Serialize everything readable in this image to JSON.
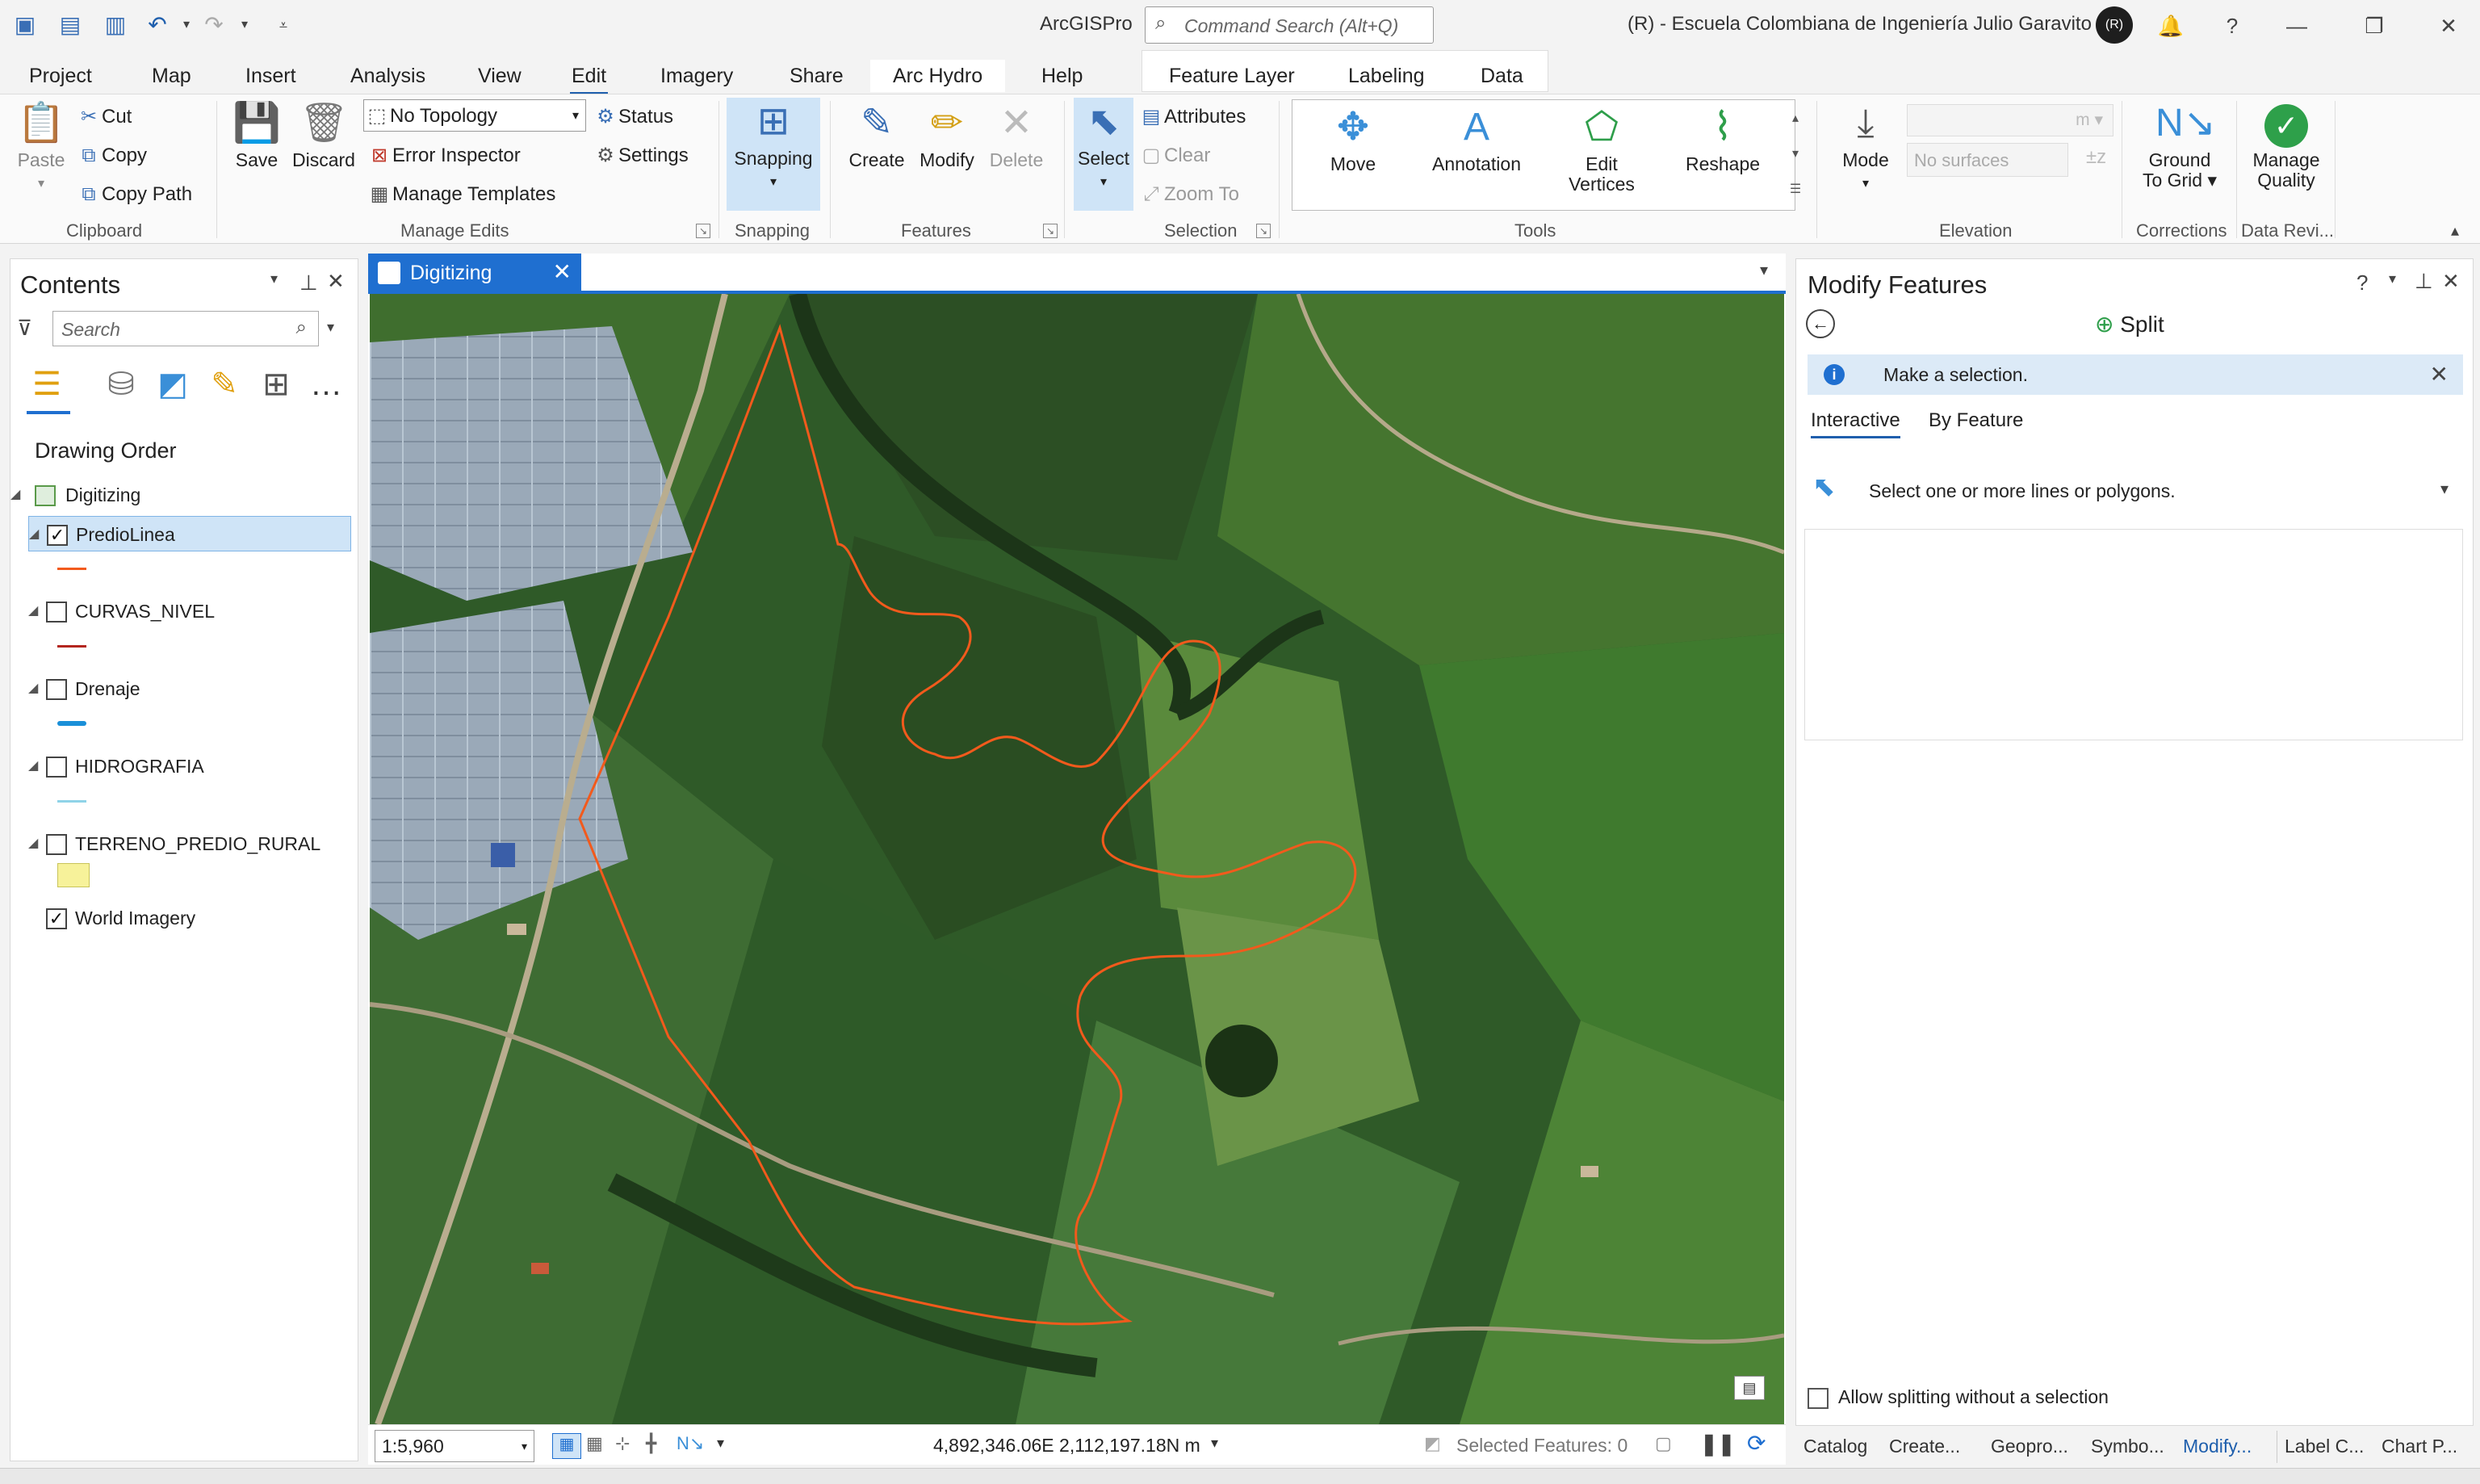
{
  "title_bar": {
    "app_title": "ArcGISPro",
    "command_search_placeholder": "Command Search (Alt+Q)",
    "user_org": "(R) - Escuela Colombiana de Ingeniería Julio Garavito",
    "avatar_initials": "(R)",
    "help": "?"
  },
  "ribbon_tabs": [
    "Project",
    "Map",
    "Insert",
    "Analysis",
    "View",
    "Edit",
    "Imagery",
    "Share",
    "Arc Hydro",
    "Help"
  ],
  "contextual_tabs": [
    "Feature Layer",
    "Labeling",
    "Data"
  ],
  "active_tab": "Edit",
  "ribbon": {
    "clipboard": {
      "label": "Clipboard",
      "paste": "Paste",
      "cut": "Cut",
      "copy": "Copy",
      "copy_path": "Copy Path"
    },
    "manage_edits": {
      "label": "Manage Edits",
      "save": "Save",
      "discard": "Discard",
      "topology_value": "No Topology",
      "status": "Status",
      "error_inspector": "Error Inspector",
      "settings": "Settings",
      "manage_templates": "Manage Templates"
    },
    "snapping": {
      "label": "Snapping",
      "button": "Snapping"
    },
    "features": {
      "label": "Features",
      "create": "Create",
      "modify": "Modify",
      "delete": "Delete"
    },
    "selection": {
      "label": "Selection",
      "select": "Select",
      "attributes": "Attributes",
      "clear": "Clear",
      "zoom_to": "Zoom To"
    },
    "tools": {
      "label": "Tools",
      "move": "Move",
      "annotation": "Annotation",
      "edit_vertices_1": "Edit",
      "edit_vertices_2": "Vertices",
      "reshape": "Reshape"
    },
    "elevation": {
      "label": "Elevation",
      "mode": "Mode",
      "unit": "m",
      "surface_placeholder": "No surfaces"
    },
    "corrections": {
      "label": "Corrections",
      "ground_to_grid_1": "Ground",
      "ground_to_grid_2": "To Grid"
    },
    "data_reviewer": {
      "label": "Data Revi...",
      "manage_quality_1": "Manage",
      "manage_quality_2": "Quality"
    }
  },
  "contents": {
    "title": "Contents",
    "search_placeholder": "Search",
    "drawing_order": "Drawing Order",
    "map_name": "Digitizing",
    "layers": [
      {
        "name": "PredioLinea",
        "checked": "✓",
        "color": "#f25a1c"
      },
      {
        "name": "CURVAS_NIVEL",
        "checked": "",
        "color": "#b3261e"
      },
      {
        "name": "Drenaje",
        "checked": "",
        "color": "#1a8fd8"
      },
      {
        "name": "HIDROGRAFIA",
        "checked": "",
        "color": "#8fd3e8"
      },
      {
        "name": "TERRENO_PREDIO_RURAL",
        "checked": "",
        "color": "#f7f29a"
      },
      {
        "name": "World Imagery",
        "checked": "✓",
        "color": ""
      }
    ]
  },
  "map_view": {
    "tab_label": "Digitizing",
    "scale": "1:5,960",
    "coordinates": "4,892,346.06E 2,112,197.18N m",
    "selected_features": "Selected Features: 0"
  },
  "modify_pane": {
    "title": "Modify Features",
    "tool": "Split",
    "info": "Make a selection.",
    "tabs": [
      "Interactive",
      "By Feature"
    ],
    "hint": "Select one or more lines or polygons.",
    "allow_split": "Allow splitting without a selection"
  },
  "bottom_tabs": [
    "Catalog",
    "Create...",
    "Geopro...",
    "Symbo...",
    "Modify...",
    "Label C...",
    "Chart P..."
  ],
  "active_bottom_tab": "Modify..."
}
